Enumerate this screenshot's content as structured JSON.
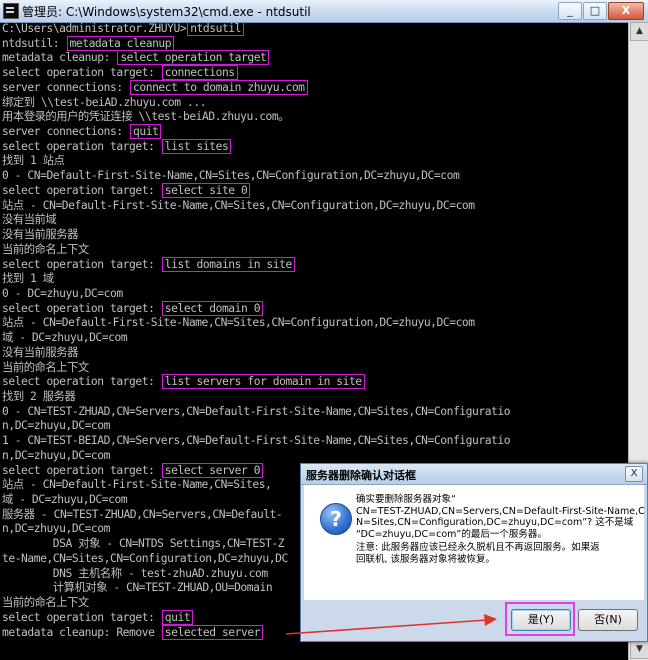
{
  "window": {
    "title": "管理员: C:\\Windows\\system32\\cmd.exe - ntdsutil",
    "min": "_",
    "max": "□",
    "close": "X"
  },
  "scrollbar": {
    "up": "▲",
    "down": "▼"
  },
  "console": {
    "lines": [
      {
        "text": "C:\\Users\\administrator.ZHUYU>",
        "cmd": "ntdsutil"
      },
      {
        "text": "ntdsutil: ",
        "cmd": "metadata cleanup"
      },
      {
        "text": "metadata cleanup: ",
        "cmd": "select operation target"
      },
      {
        "text": "select operation target: ",
        "cmd": "connections"
      },
      {
        "text": "server connections: ",
        "cmd": "connect to domain zhuyu.com"
      },
      {
        "text": "绑定到 \\\\test-beiAD.zhuyu.com ..."
      },
      {
        "text": "用本登录的用户的凭证连接 \\\\test-beiAD.zhuyu.com。"
      },
      {
        "text": "server connections: ",
        "cmd": "quit"
      },
      {
        "text": "select operation target: ",
        "cmd": "list sites"
      },
      {
        "text": "找到 1 站点"
      },
      {
        "text": "0 - CN=Default-First-Site-Name,CN=Sites,CN=Configuration,DC=zhuyu,DC=com"
      },
      {
        "text": "select operation target: ",
        "cmd": "select site 0"
      },
      {
        "text": "站点 - CN=Default-First-Site-Name,CN=Sites,CN=Configuration,DC=zhuyu,DC=com"
      },
      {
        "text": "没有当前域"
      },
      {
        "text": "没有当前服务器"
      },
      {
        "text": "当前的命名上下文"
      },
      {
        "text": "select operation target: ",
        "cmd": "list domains in site"
      },
      {
        "text": "找到 1 域"
      },
      {
        "text": "0 - DC=zhuyu,DC=com"
      },
      {
        "text": "select operation target: ",
        "cmd": "select domain 0"
      },
      {
        "text": "站点 - CN=Default-First-Site-Name,CN=Sites,CN=Configuration,DC=zhuyu,DC=com"
      },
      {
        "text": "域 - DC=zhuyu,DC=com"
      },
      {
        "text": "没有当前服务器"
      },
      {
        "text": "当前的命名上下文"
      },
      {
        "text": "select operation target: ",
        "cmd": "list servers for domain in site"
      },
      {
        "text": "找到 2 服务器"
      },
      {
        "text": "0 - CN=TEST-ZHUAD,CN=Servers,CN=Default-First-Site-Name,CN=Sites,CN=Configuratio"
      },
      {
        "text": "n,DC=zhuyu,DC=com"
      },
      {
        "text": "1 - CN=TEST-BEIAD,CN=Servers,CN=Default-First-Site-Name,CN=Sites,CN=Configuratio"
      },
      {
        "text": "n,DC=zhuyu,DC=com"
      },
      {
        "text": "select operation target: ",
        "cmd": "select server 0"
      },
      {
        "text": "站点 - CN=Default-First-Site-Name,CN=Sites,"
      },
      {
        "text": "域 - DC=zhuyu,DC=com"
      },
      {
        "text": "服务器 - CN=TEST-ZHUAD,CN=Servers,CN=Default-"
      },
      {
        "text": "n,DC=zhuyu,DC=com"
      },
      {
        "text": "        DSA 对象 - CN=NTDS Settings,CN=TEST-Z"
      },
      {
        "text": "te-Name,CN=Sites,CN=Configuration,DC=zhuyu,DC"
      },
      {
        "text": "        DNS 主机名称 - test-zhuAD.zhuyu.com"
      },
      {
        "text": "        计算机对象 - CN=TEST-ZHUAD,OU=Domain"
      },
      {
        "text": "当前的命名上下文"
      },
      {
        "text": "select operation target: ",
        "cmd": "quit"
      },
      {
        "text": "metadata cleanup: Remove ",
        "cmd": "selected server"
      }
    ]
  },
  "dialog": {
    "title": "服务器删除确认对话框",
    "close": "X",
    "icon": "question-icon",
    "message": [
      "确实要删除服务器对象“",
      "CN=TEST-ZHUAD,CN=Servers,CN=Default-First-Site-Name,C",
      "N=Sites,CN=Configuration,DC=zhuyu,DC=com”? 这不是域",
      "“DC=zhuyu,DC=com”的最后一个服务器。"
    ],
    "note": [
      "注意: 此服务器应该已经永久脱机且不再返回服务。如果返",
      "回联机, 该服务器对象将被恢复。"
    ],
    "yes_label": "是(Y)",
    "no_label": "否(N)"
  },
  "colors": {
    "highlight": "#d01ad7",
    "arrow": "#e03030",
    "console_text": "#c0c0c0"
  }
}
